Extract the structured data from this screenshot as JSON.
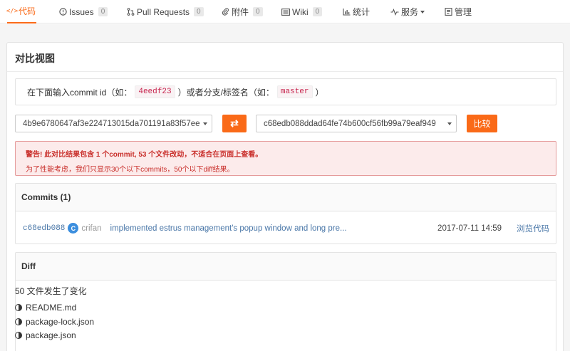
{
  "nav": {
    "tabs": [
      {
        "label": "代码",
        "icon": "code-icon",
        "count": null,
        "active": true
      },
      {
        "label": "Issues",
        "icon": "issue-icon",
        "count": "0"
      },
      {
        "label": "Pull Requests",
        "icon": "pull-request-icon",
        "count": "0"
      },
      {
        "label": "附件",
        "icon": "attachment-icon",
        "count": "0"
      },
      {
        "label": "Wiki",
        "icon": "wiki-icon",
        "count": "0"
      },
      {
        "label": "统计",
        "icon": "stats-icon"
      },
      {
        "label": "服务",
        "icon": "service-icon"
      },
      {
        "label": "管理",
        "icon": "manage-icon"
      }
    ],
    "accent": "#fa6a18"
  },
  "page": {
    "title": "对比视图",
    "hint_prefix": "在下面输入commit id（如：",
    "hint_example_commit": "4eedf23",
    "hint_middle": "）或者分支/标签名（如：",
    "hint_example_branch": "master",
    "hint_suffix": "）"
  },
  "compare": {
    "base": "4b9e6780647af3e224713015da701191a83f57ee",
    "head": "c68edb088ddad64fe74b600cf56fb99a79eaf949",
    "swap_label": "⇄",
    "compare_label": "比较"
  },
  "alert": {
    "line1": "警告! 此对比结果包含 1 个commit, 53 个文件改动，不适合在页面上查看。",
    "line2": "为了性能考虑，我们只显示30个以下commits，50个以下diff结果。"
  },
  "commits": {
    "header": "Commits (1)",
    "rows": [
      {
        "sha": "c68edb088",
        "avatar_letter": "C",
        "author": "crifan",
        "message": "implemented estrus management's popup window and long pre...",
        "date": "2017-07-11 14:59",
        "browse_label": "浏览代码"
      }
    ]
  },
  "diff": {
    "header": "Diff",
    "summary": "50 文件发生了变化",
    "files": [
      "README.md",
      "package-lock.json",
      "package.json"
    ]
  }
}
